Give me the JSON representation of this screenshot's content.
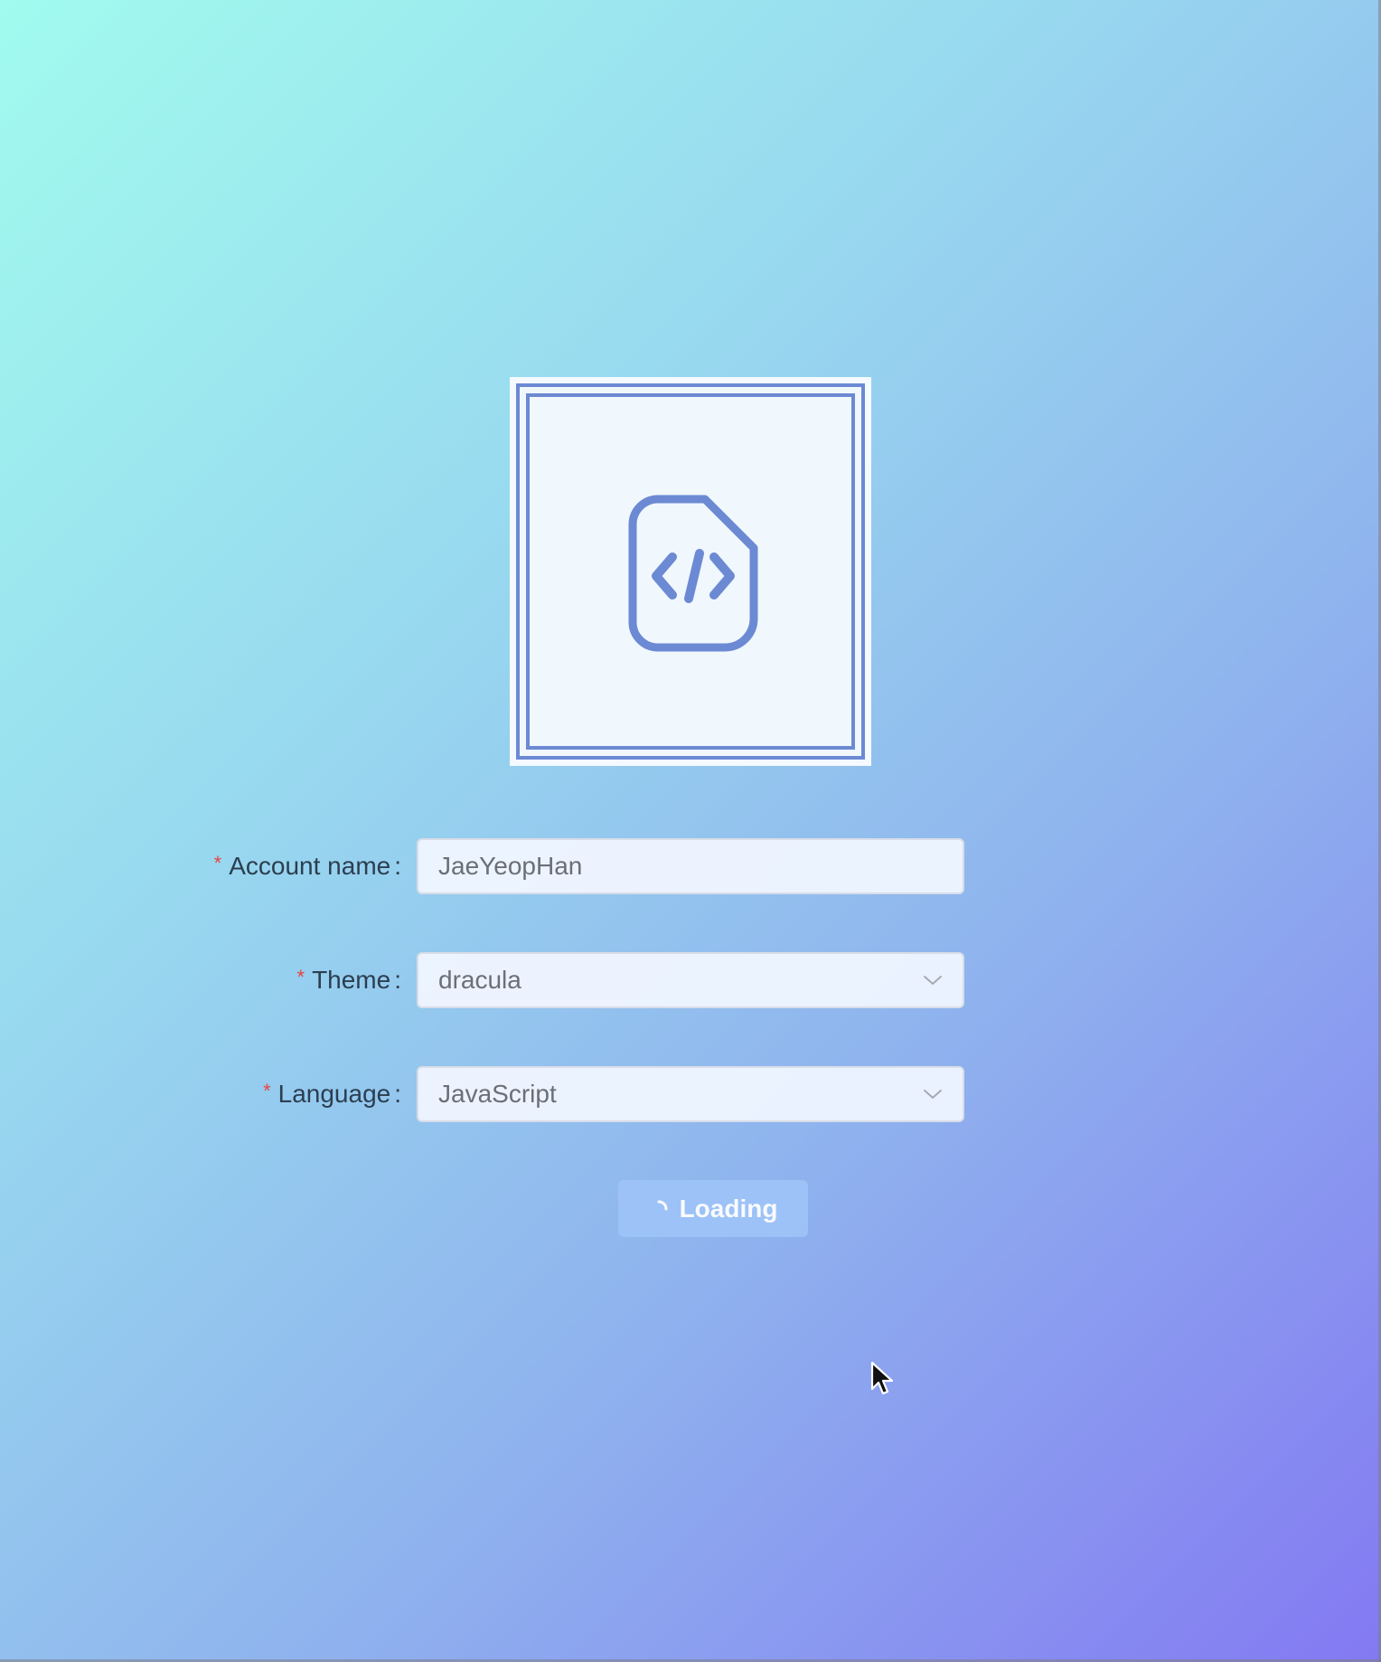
{
  "form": {
    "account_name": {
      "label": "Account name",
      "required": "*",
      "colon": ":",
      "value": "JaeYeopHan"
    },
    "theme": {
      "label": "Theme",
      "required": "*",
      "colon": ":",
      "value": "dracula"
    },
    "language": {
      "label": "Language",
      "required": "*",
      "colon": ":",
      "value": "JavaScript"
    }
  },
  "submit": {
    "label": "Loading",
    "state": "loading"
  },
  "icons": {
    "logo": "code-file-icon",
    "select_arrow": "chevron-down-icon",
    "button_spinner": "spinner-icon",
    "pointer": "mouse-cursor-icon"
  },
  "colors": {
    "background_start": "#a1fbee",
    "background_end": "#8379f2",
    "logo_stroke": "#6c8ad3",
    "required": "#e64545",
    "label_text": "#2c3e50",
    "button_bg": "#9ec3f8"
  }
}
